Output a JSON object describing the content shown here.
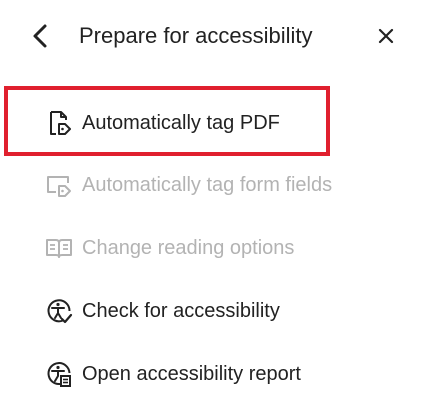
{
  "header": {
    "title": "Prepare for accessibility",
    "back_icon": "chevron-left-icon",
    "close_icon": "close-icon"
  },
  "items": [
    {
      "label": "Automatically tag PDF",
      "icon": "tag-pdf-icon",
      "enabled": true,
      "highlighted": true
    },
    {
      "label": "Automatically tag form fields",
      "icon": "tag-form-fields-icon",
      "enabled": false
    },
    {
      "label": "Change reading options",
      "icon": "reading-options-icon",
      "enabled": false
    },
    {
      "label": "Check for accessibility",
      "icon": "accessibility-check-icon",
      "enabled": true
    },
    {
      "label": "Open accessibility report",
      "icon": "accessibility-report-icon",
      "enabled": true
    }
  ],
  "colors": {
    "text": "#222222",
    "disabled_text": "#b3b3b3",
    "highlight_border": "#e0202e"
  }
}
